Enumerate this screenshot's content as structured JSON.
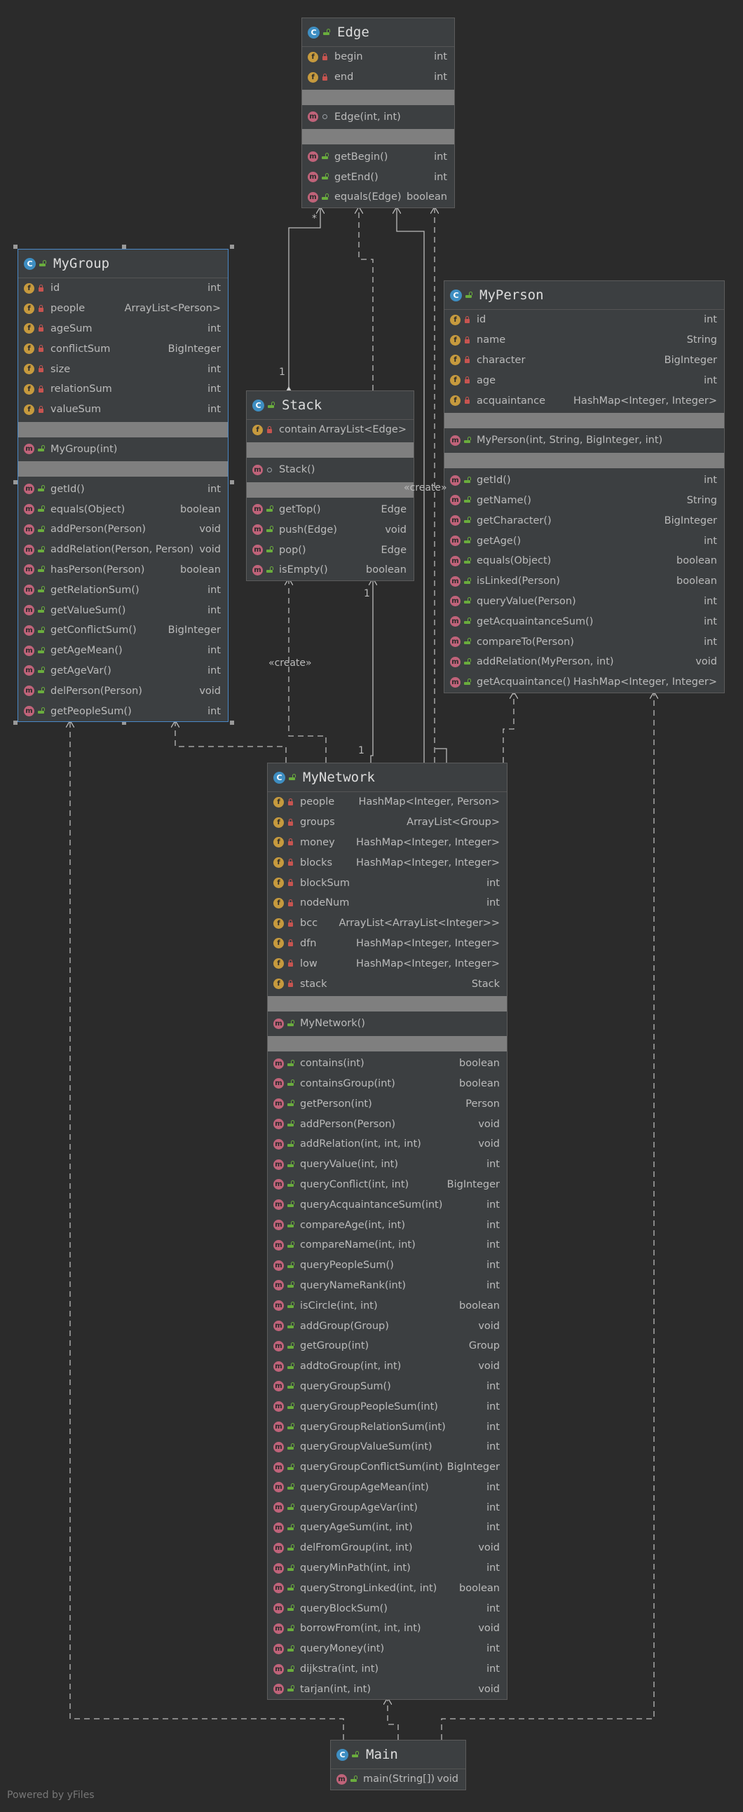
{
  "classes": {
    "edge": {
      "name": "Edge",
      "fields": [
        {
          "name": "begin",
          "type": "int"
        },
        {
          "name": "end",
          "type": "int"
        }
      ],
      "constructors": [
        {
          "name": "Edge(int, int)",
          "type": ""
        }
      ],
      "methods": [
        {
          "name": "getBegin()",
          "type": "int"
        },
        {
          "name": "getEnd()",
          "type": "int"
        },
        {
          "name": "equals(Edge)",
          "type": "boolean"
        }
      ]
    },
    "mygroup": {
      "name": "MyGroup",
      "fields": [
        {
          "name": "id",
          "type": "int"
        },
        {
          "name": "people",
          "type": "ArrayList<Person>"
        },
        {
          "name": "ageSum",
          "type": "int"
        },
        {
          "name": "conflictSum",
          "type": "BigInteger"
        },
        {
          "name": "size",
          "type": "int"
        },
        {
          "name": "relationSum",
          "type": "int"
        },
        {
          "name": "valueSum",
          "type": "int"
        }
      ],
      "constructors": [
        {
          "name": "MyGroup(int)",
          "type": ""
        }
      ],
      "methods": [
        {
          "name": "getId()",
          "type": "int"
        },
        {
          "name": "equals(Object)",
          "type": "boolean"
        },
        {
          "name": "addPerson(Person)",
          "type": "void"
        },
        {
          "name": "addRelation(Person, Person)",
          "type": "void"
        },
        {
          "name": "hasPerson(Person)",
          "type": "boolean"
        },
        {
          "name": "getRelationSum()",
          "type": "int"
        },
        {
          "name": "getValueSum()",
          "type": "int"
        },
        {
          "name": "getConflictSum()",
          "type": "BigInteger"
        },
        {
          "name": "getAgeMean()",
          "type": "int"
        },
        {
          "name": "getAgeVar()",
          "type": "int"
        },
        {
          "name": "delPerson(Person)",
          "type": "void"
        },
        {
          "name": "getPeopleSum()",
          "type": "int"
        }
      ]
    },
    "stack": {
      "name": "Stack",
      "fields": [
        {
          "name": "contain",
          "type": "ArrayList<Edge>"
        }
      ],
      "constructors": [
        {
          "name": "Stack()",
          "type": ""
        }
      ],
      "methods": [
        {
          "name": "getTop()",
          "type": "Edge"
        },
        {
          "name": "push(Edge)",
          "type": "void"
        },
        {
          "name": "pop()",
          "type": "Edge"
        },
        {
          "name": "isEmpty()",
          "type": "boolean"
        }
      ]
    },
    "myperson": {
      "name": "MyPerson",
      "fields": [
        {
          "name": "id",
          "type": "int"
        },
        {
          "name": "name",
          "type": "String"
        },
        {
          "name": "character",
          "type": "BigInteger"
        },
        {
          "name": "age",
          "type": "int"
        },
        {
          "name": "acquaintance",
          "type": "HashMap<Integer, Integer>"
        }
      ],
      "constructors": [
        {
          "name": "MyPerson(int, String, BigInteger, int)",
          "type": ""
        }
      ],
      "methods": [
        {
          "name": "getId()",
          "type": "int"
        },
        {
          "name": "getName()",
          "type": "String"
        },
        {
          "name": "getCharacter()",
          "type": "BigInteger"
        },
        {
          "name": "getAge()",
          "type": "int"
        },
        {
          "name": "equals(Object)",
          "type": "boolean"
        },
        {
          "name": "isLinked(Person)",
          "type": "boolean"
        },
        {
          "name": "queryValue(Person)",
          "type": "int"
        },
        {
          "name": "getAcquaintanceSum()",
          "type": "int"
        },
        {
          "name": "compareTo(Person)",
          "type": "int"
        },
        {
          "name": "addRelation(MyPerson, int)",
          "type": "void"
        },
        {
          "name": "getAcquaintance()",
          "type": "HashMap<Integer, Integer>"
        }
      ]
    },
    "mynetwork": {
      "name": "MyNetwork",
      "fields": [
        {
          "name": "people",
          "type": "HashMap<Integer, Person>"
        },
        {
          "name": "groups",
          "type": "ArrayList<Group>"
        },
        {
          "name": "money",
          "type": "HashMap<Integer, Integer>"
        },
        {
          "name": "blocks",
          "type": "HashMap<Integer, Integer>"
        },
        {
          "name": "blockSum",
          "type": "int"
        },
        {
          "name": "nodeNum",
          "type": "int"
        },
        {
          "name": "bcc",
          "type": "ArrayList<ArrayList<Integer>>"
        },
        {
          "name": "dfn",
          "type": "HashMap<Integer, Integer>"
        },
        {
          "name": "low",
          "type": "HashMap<Integer, Integer>"
        },
        {
          "name": "stack",
          "type": "Stack"
        }
      ],
      "constructors": [
        {
          "name": "MyNetwork()",
          "type": ""
        }
      ],
      "methods": [
        {
          "name": "contains(int)",
          "type": "boolean"
        },
        {
          "name": "containsGroup(int)",
          "type": "boolean"
        },
        {
          "name": "getPerson(int)",
          "type": "Person"
        },
        {
          "name": "addPerson(Person)",
          "type": "void"
        },
        {
          "name": "addRelation(int, int, int)",
          "type": "void"
        },
        {
          "name": "queryValue(int, int)",
          "type": "int"
        },
        {
          "name": "queryConflict(int, int)",
          "type": "BigInteger"
        },
        {
          "name": "queryAcquaintanceSum(int)",
          "type": "int"
        },
        {
          "name": "compareAge(int, int)",
          "type": "int"
        },
        {
          "name": "compareName(int, int)",
          "type": "int"
        },
        {
          "name": "queryPeopleSum()",
          "type": "int"
        },
        {
          "name": "queryNameRank(int)",
          "type": "int"
        },
        {
          "name": "isCircle(int, int)",
          "type": "boolean"
        },
        {
          "name": "addGroup(Group)",
          "type": "void"
        },
        {
          "name": "getGroup(int)",
          "type": "Group"
        },
        {
          "name": "addtoGroup(int, int)",
          "type": "void"
        },
        {
          "name": "queryGroupSum()",
          "type": "int"
        },
        {
          "name": "queryGroupPeopleSum(int)",
          "type": "int"
        },
        {
          "name": "queryGroupRelationSum(int)",
          "type": "int"
        },
        {
          "name": "queryGroupValueSum(int)",
          "type": "int"
        },
        {
          "name": "queryGroupConflictSum(int)",
          "type": "BigInteger"
        },
        {
          "name": "queryGroupAgeMean(int)",
          "type": "int"
        },
        {
          "name": "queryGroupAgeVar(int)",
          "type": "int"
        },
        {
          "name": "queryAgeSum(int, int)",
          "type": "int"
        },
        {
          "name": "delFromGroup(int, int)",
          "type": "void"
        },
        {
          "name": "queryMinPath(int, int)",
          "type": "int"
        },
        {
          "name": "queryStrongLinked(int, int)",
          "type": "boolean"
        },
        {
          "name": "queryBlockSum()",
          "type": "int"
        },
        {
          "name": "borrowFrom(int, int, int)",
          "type": "void"
        },
        {
          "name": "queryMoney(int)",
          "type": "int"
        },
        {
          "name": "dijkstra(int, int)",
          "type": "int"
        },
        {
          "name": "tarjan(int, int)",
          "type": "void"
        }
      ]
    },
    "main": {
      "name": "Main",
      "fields": [],
      "constructors": [],
      "methods": [
        {
          "name": "main(String[])",
          "type": "void"
        }
      ]
    }
  },
  "labels": {
    "create1": "«create»",
    "create2": "«create»",
    "mult_star": "*",
    "mult_one_stack": "1",
    "mult_one_net_stack": "1",
    "mult_one_net": "1"
  },
  "footer": "Powered by yFiles",
  "colors": {
    "background": "#2b2b2b",
    "panel": "#3c3f41",
    "field_badge": "#c69a3e",
    "method_badge": "#c0637a",
    "class_badge": "#3e8ec2",
    "selection": "#4a88c7"
  }
}
